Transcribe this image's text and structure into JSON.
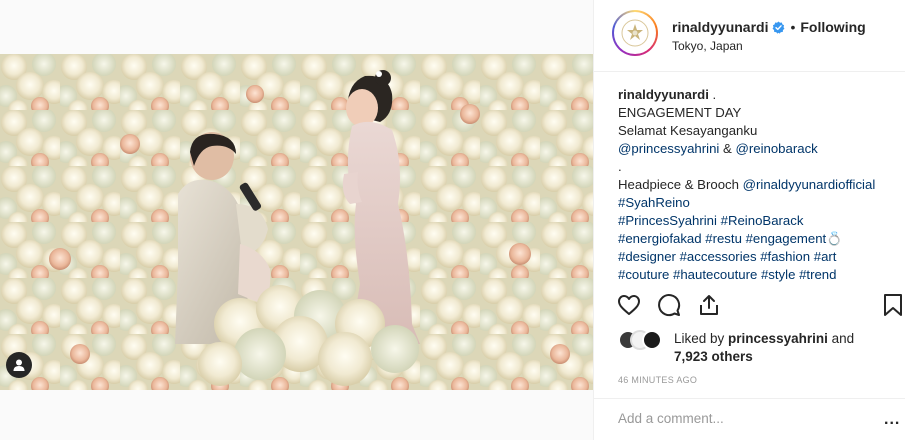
{
  "post": {
    "username": "rinaldyyunardi",
    "follow_separator": "•",
    "follow_status": "Following",
    "location": "Tokyo, Japan",
    "caption_username": "rinaldyyunardi",
    "caption_lines": {
      "l1_rest": " .",
      "l2": "ENGAGEMENT DAY",
      "l3": "Selamat Kesayanganku",
      "l4_mention1": "@princessyahrini",
      "l4_amp": " & ",
      "l4_mention2": "@reinobarack",
      "l5": ".",
      "l6_text": "Headpiece & Brooch ",
      "l6_mention": "@rinaldyyunardiofficial",
      "l7": "#SyahReino",
      "l8": "#PrincesSyahrini #ReinoBarack",
      "l9": "#energiofakad #restu #engagement💍",
      "l10": "#designer #accessories #fashion #art",
      "l11": "#couture #hautecouture #style #trend"
    },
    "likes": {
      "prefix": "Liked by ",
      "user": "princessyahrini",
      "and": " and",
      "others": "7,923 others"
    },
    "timestamp": "46 MINUTES AGO",
    "comment_placeholder": "Add a comment...",
    "more_label": "..."
  },
  "icons": {
    "verified": "verified-badge-icon",
    "like": "heart-icon",
    "comment": "comment-icon",
    "share": "share-icon",
    "save": "bookmark-icon",
    "user_tag": "user-tag-icon"
  },
  "colors": {
    "text": "#262626",
    "link": "#003569",
    "muted": "#999999",
    "verified": "#3897f0",
    "border": "#efefef"
  }
}
